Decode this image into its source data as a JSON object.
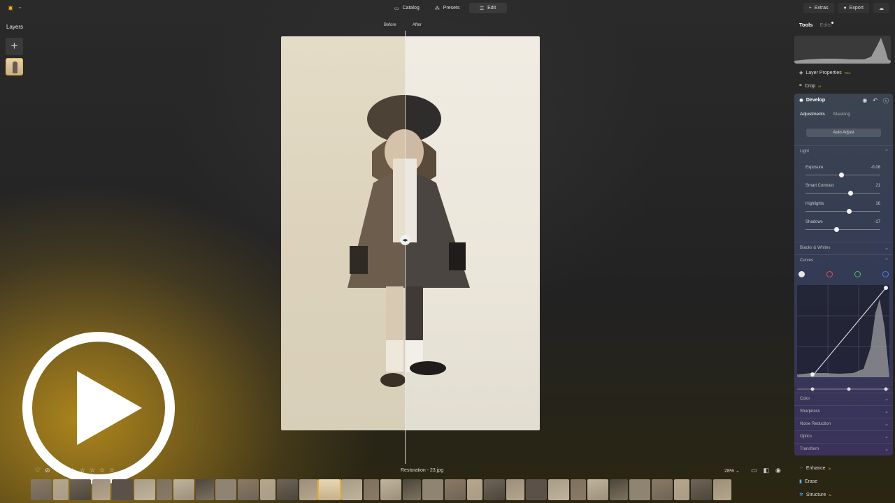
{
  "topbar": {
    "modes": [
      {
        "label": "Catalog",
        "icon": "folder-icon"
      },
      {
        "label": "Presets",
        "icon": "presets-icon"
      },
      {
        "label": "Edit",
        "icon": "sliders-icon"
      }
    ],
    "extras_label": "Extras",
    "export_label": "Export"
  },
  "layers": {
    "title": "Layers",
    "add_glyph": "+"
  },
  "compare": {
    "before": "Before",
    "after": "After"
  },
  "footer": {
    "filename": "Restoration - 23.jpg",
    "zoom": "28%",
    "stars": [
      "☆",
      "☆",
      "☆",
      "☆",
      "☆"
    ]
  },
  "panel": {
    "tabs": {
      "tools": "Tools",
      "edits": "Edits"
    },
    "layer_properties": "Layer Properties",
    "crop": "Crop",
    "develop": {
      "title": "Develop",
      "subtabs": {
        "adjustments": "Adjustments",
        "masking": "Masking"
      },
      "auto_adjust": "Auto Adjust",
      "sections": {
        "light": "Light",
        "blacks_whites": "Blacks & Whites",
        "curves": "Curves",
        "color": "Color",
        "sharpness": "Sharpness",
        "noise_reduction": "Noise Reduction",
        "optics": "Optics",
        "transform": "Transform"
      },
      "sliders": [
        {
          "label": "Exposure",
          "value": "-0.08",
          "level": 0.48
        },
        {
          "label": "Smart Contrast",
          "value": "21",
          "level": 0.6
        },
        {
          "label": "Highlights",
          "value": "16",
          "level": 0.58
        },
        {
          "label": "Shadows",
          "value": "-17",
          "level": 0.42
        }
      ],
      "curve_channels": [
        {
          "name": "luminance",
          "color": "#e6e6e6"
        },
        {
          "name": "red",
          "color": "#e0534b"
        },
        {
          "name": "green",
          "color": "#54c260"
        },
        {
          "name": "blue",
          "color": "#4f7fe6"
        }
      ]
    },
    "enhance": "Enhance",
    "erase": "Erase",
    "structure": "Structure",
    "ai_badge": "AI",
    "pro_badge": "PRO"
  },
  "colors": {
    "accent": "#e7b030"
  }
}
